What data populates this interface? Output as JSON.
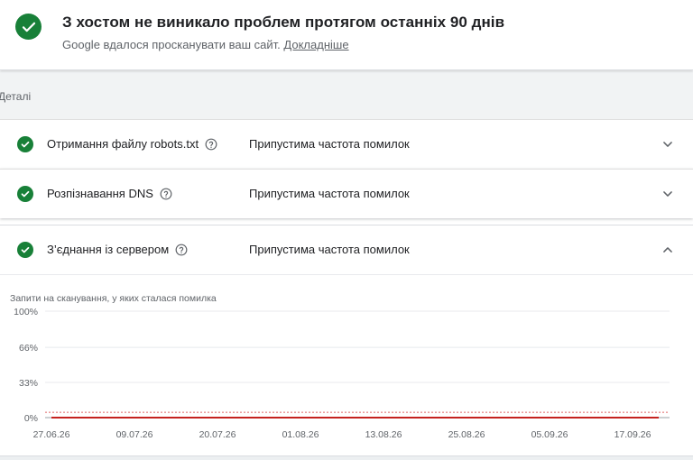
{
  "header": {
    "title": "З хостом не виникало проблем протягом останніх 90 днів",
    "subtitle": "Google вдалося просканувати ваш сайт.",
    "learn_more": "Докладніше",
    "status_color": "#188038",
    "icon": "check-circle-icon"
  },
  "details": {
    "label": "Деталі"
  },
  "rows": [
    {
      "name": "Отримання файлу robots.txt",
      "status": "Припустима частота помилок",
      "expanded": false
    },
    {
      "name": "Розпізнавання DNS",
      "status": "Припустима частота помилок",
      "expanded": false
    },
    {
      "name": "З’єднання із сервером",
      "status": "Припустима частота помилок",
      "expanded": true
    }
  ],
  "chart_data": {
    "type": "line",
    "title": "Запити на сканування, у яких сталася помилка",
    "x": [
      "27.06.26",
      "09.07.26",
      "20.07.26",
      "01.08.26",
      "13.08.26",
      "25.08.26",
      "05.09.26",
      "17.09.26"
    ],
    "yticks": [
      "100%",
      "66%",
      "33%",
      "0%"
    ],
    "ytick_values": [
      100,
      66,
      33,
      0
    ],
    "ylim": [
      0,
      100
    ],
    "series": [
      {
        "values": [
          0,
          0,
          0,
          0,
          0,
          0,
          0,
          0
        ],
        "color": "#c5221f"
      }
    ],
    "threshold": {
      "value": 5,
      "color": "#e06666",
      "style": "dotted"
    },
    "grid": true
  }
}
